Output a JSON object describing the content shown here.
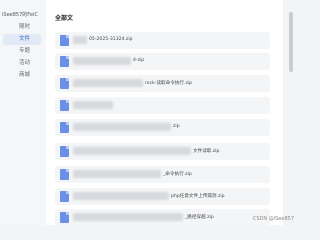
{
  "sidebar": {
    "brand": "iSee857的FeiC",
    "items": [
      {
        "label": "随时",
        "active": false
      },
      {
        "label": "文件",
        "active": true
      },
      {
        "label": "专题",
        "active": false
      },
      {
        "label": "活动",
        "active": false
      },
      {
        "label": "商城",
        "active": false
      }
    ]
  },
  "main": {
    "section_title": "全部文",
    "files": [
      {
        "name": "05-2025-31324.zip"
      },
      {
        "name": "4-zip"
      },
      {
        "name": "rock-读取命令执行.zip"
      },
      {
        "name": ""
      },
      {
        "name": "zip"
      },
      {
        "name": "文件读取.zip"
      },
      {
        "name": "_命令执行.zip"
      },
      {
        "name": "php任意文件上传漏洞.zip"
      },
      {
        "name": "_路径穿越.zip"
      }
    ]
  },
  "watermark": "CSDN @iSee857"
}
